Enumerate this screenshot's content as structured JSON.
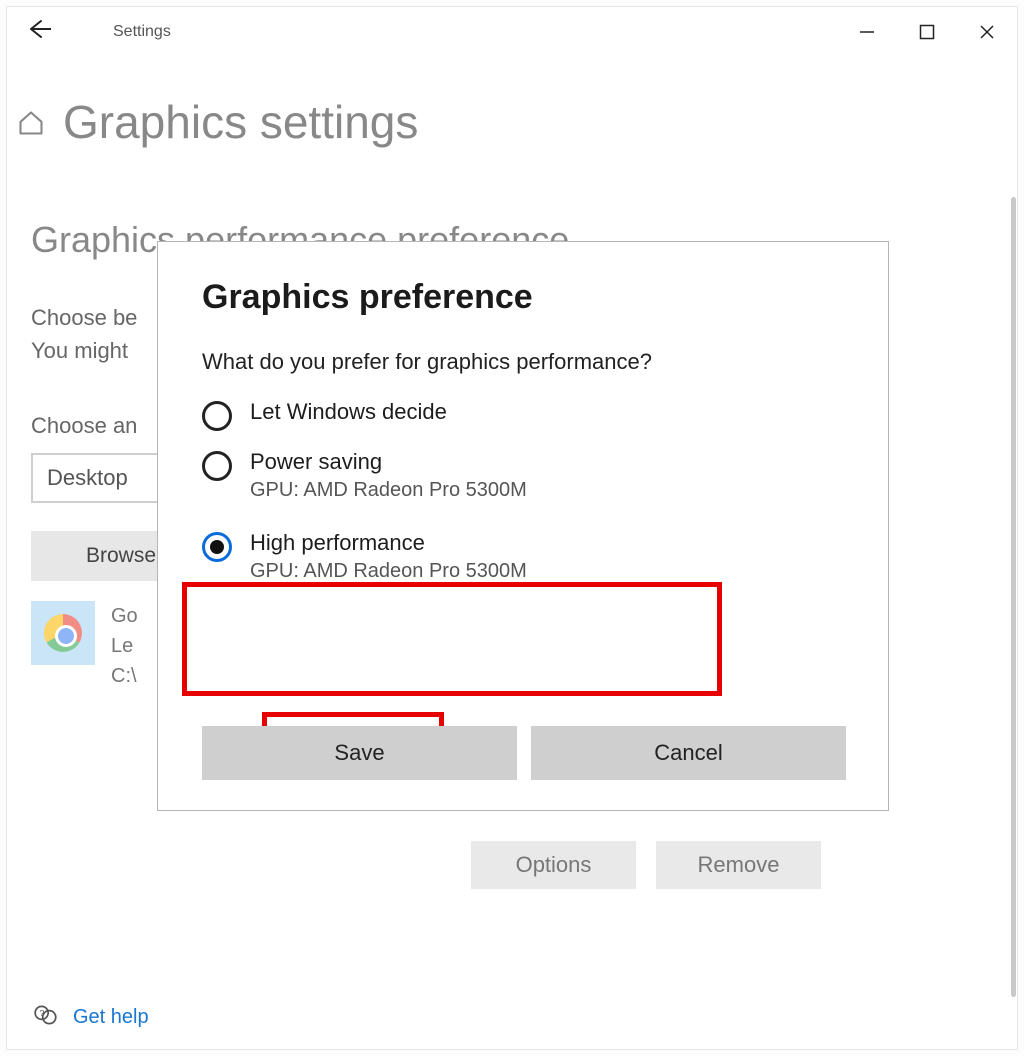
{
  "titlebar": {
    "title": "Settings"
  },
  "page": {
    "title": "Graphics settings",
    "section_title": "Graphics performance preference",
    "desc_line1": "Choose be",
    "desc_line2": "You might",
    "choose_label": "Choose an",
    "dropdown_value": "Desktop",
    "browse_label": "Browse"
  },
  "app": {
    "name": "Go",
    "pref": "Le",
    "path": "C:\\",
    "options_label": "Options",
    "remove_label": "Remove"
  },
  "help": {
    "label": "Get help"
  },
  "dialog": {
    "title": "Graphics preference",
    "question": "What do you prefer for graphics performance?",
    "options": [
      {
        "label": "Let Windows decide",
        "sub": ""
      },
      {
        "label": "Power saving",
        "sub": "GPU: AMD Radeon Pro 5300M"
      },
      {
        "label": "High performance",
        "sub": "GPU: AMD Radeon Pro 5300M"
      }
    ],
    "save_label": "Save",
    "cancel_label": "Cancel",
    "selected_index": 2
  }
}
